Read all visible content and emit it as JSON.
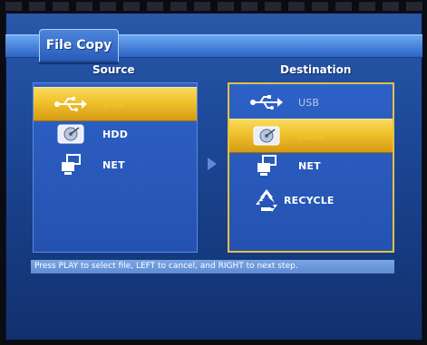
{
  "window": {
    "title": "File Copy"
  },
  "columns": {
    "source": "Source",
    "destination": "Destination"
  },
  "source": {
    "items": [
      {
        "id": "usb",
        "label": "USB",
        "selected": true
      },
      {
        "id": "hdd",
        "label": "HDD",
        "selected": false
      },
      {
        "id": "net",
        "label": "NET",
        "selected": false
      }
    ]
  },
  "destination": {
    "items": [
      {
        "id": "usb",
        "label": "USB",
        "selected": false
      },
      {
        "id": "hdd",
        "label": "HDD",
        "selected": true
      },
      {
        "id": "net",
        "label": "NET",
        "selected": false
      },
      {
        "id": "recycle",
        "label": "RECYCLE",
        "selected": false
      }
    ]
  },
  "status_text": "Press PLAY to select file, LEFT to cancel, and RIGHT to next step.",
  "icons": {
    "usb": "usb-icon",
    "hdd": "hdd-icon",
    "net": "network-icon",
    "recycle": "recycle-icon"
  },
  "colors": {
    "selection": "#f0c12a",
    "panel": "#2552b0",
    "accent": "#e3c243"
  }
}
